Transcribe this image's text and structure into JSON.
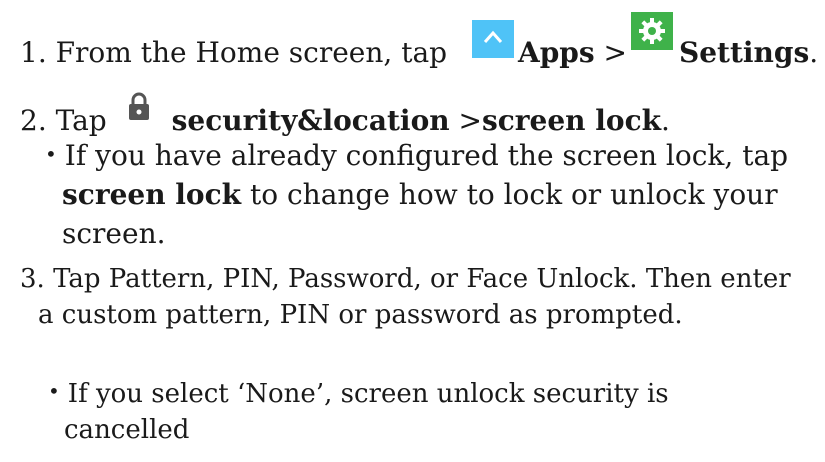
{
  "step1": {
    "text_prefix": "1. From the Home screen, tap ",
    "apps_label": "Apps",
    "separator": " >",
    "settings_label": "Settings",
    "suffix": ".",
    "apps_icon_color": "#4fc3f7",
    "settings_icon_color": "#3fb24a"
  },
  "step2": {
    "prefix": "2. Tap ",
    "security_location_label": "security&location",
    "separator": " >",
    "screen_lock_label": "screen lock",
    "suffix": ".",
    "lock_icon_color": "#555555"
  },
  "bullet1": {
    "bullet": "•",
    "line1": "If you have already configured the screen lock, tap",
    "screen_lock_label": "screen lock",
    "line2_rest": " to change how to lock or unlock your",
    "line3": "screen."
  },
  "step3": {
    "line1": "3. Tap Pattern, PIN, Password, or Face Unlock. Then enter",
    "line2": "a custom pattern, PIN or password as prompted."
  },
  "bullet2": {
    "bullet": "•",
    "line1": "If you select ‘None’, screen unlock security is",
    "line2": "cancelled"
  }
}
